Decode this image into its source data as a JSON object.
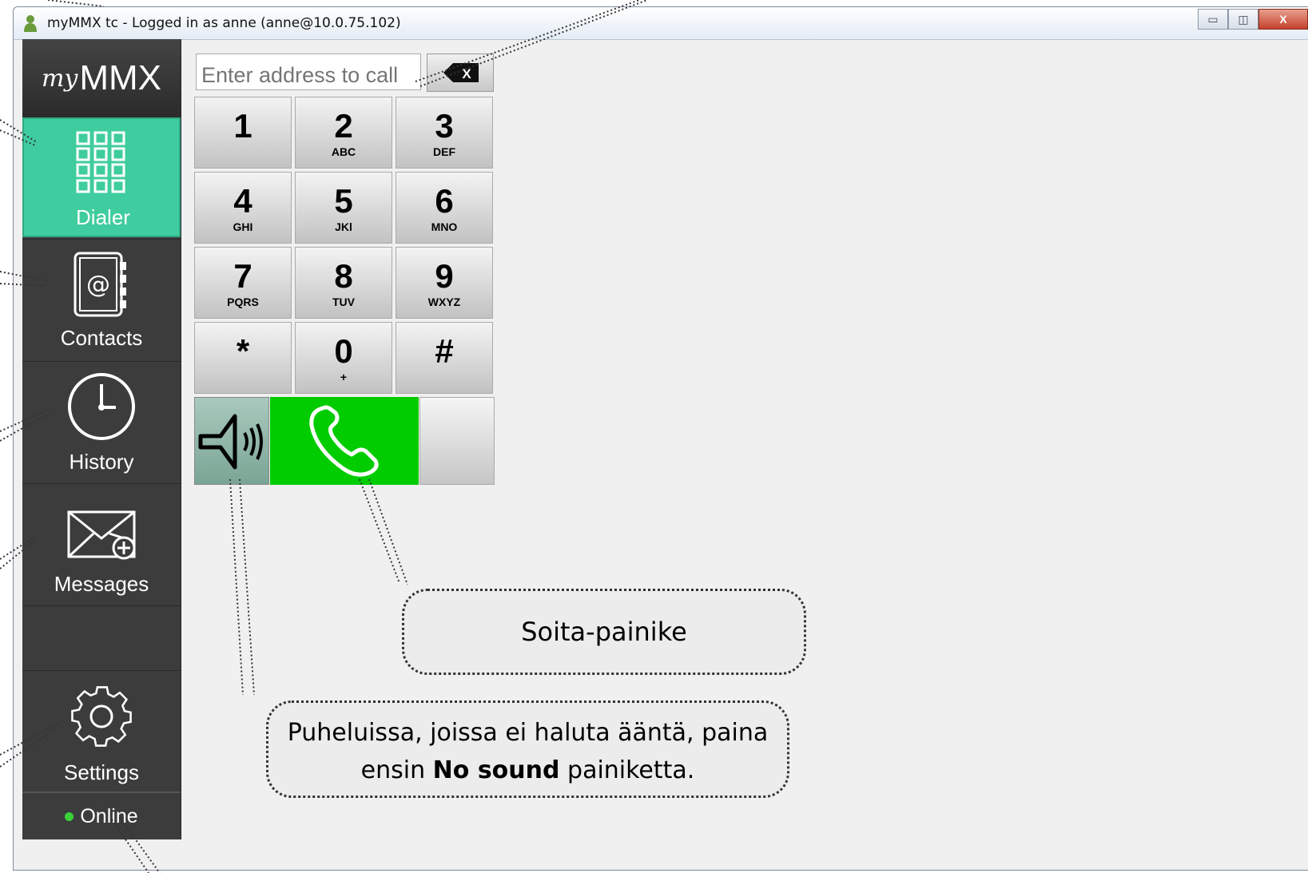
{
  "window": {
    "title": "myMMX tc - Logged in as anne (anne@10.0.75.102)",
    "controls": {
      "minimize": "▭",
      "maximize": "◫",
      "close": "X"
    }
  },
  "sidebar": {
    "logo_small": "my",
    "logo_big": "MMX",
    "items": [
      {
        "label": "Dialer",
        "icon": "dialpad-icon",
        "active": true
      },
      {
        "label": "Contacts",
        "icon": "address-book-icon"
      },
      {
        "label": "History",
        "icon": "clock-icon"
      },
      {
        "label": "Messages",
        "icon": "envelope-plus-icon"
      },
      {
        "label": "Settings",
        "icon": "gear-icon"
      }
    ],
    "status": {
      "label": "Online",
      "color": "#3ad23a"
    }
  },
  "dialer": {
    "address_placeholder": "Enter address to call",
    "clear_label": "X",
    "keys": [
      {
        "digit": "1",
        "sub": ""
      },
      {
        "digit": "2",
        "sub": "ABC"
      },
      {
        "digit": "3",
        "sub": "DEF"
      },
      {
        "digit": "4",
        "sub": "GHI"
      },
      {
        "digit": "5",
        "sub": "JKl"
      },
      {
        "digit": "6",
        "sub": "MNO"
      },
      {
        "digit": "7",
        "sub": "PQRS"
      },
      {
        "digit": "8",
        "sub": "TUV"
      },
      {
        "digit": "9",
        "sub": "WXYZ"
      },
      {
        "digit": "*",
        "sub": ""
      },
      {
        "digit": "0",
        "sub": "+"
      },
      {
        "digit": "#",
        "sub": ""
      }
    ],
    "call_color": "#00cc00",
    "active_color": "#3fcc9e"
  },
  "callouts": {
    "call_button": "Soita-painike",
    "no_sound_pre": "Puheluissa, joissa ei haluta ääntä, paina",
    "no_sound_mid1": "ensin ",
    "no_sound_bold": "No sound",
    "no_sound_mid2": " painiketta."
  }
}
